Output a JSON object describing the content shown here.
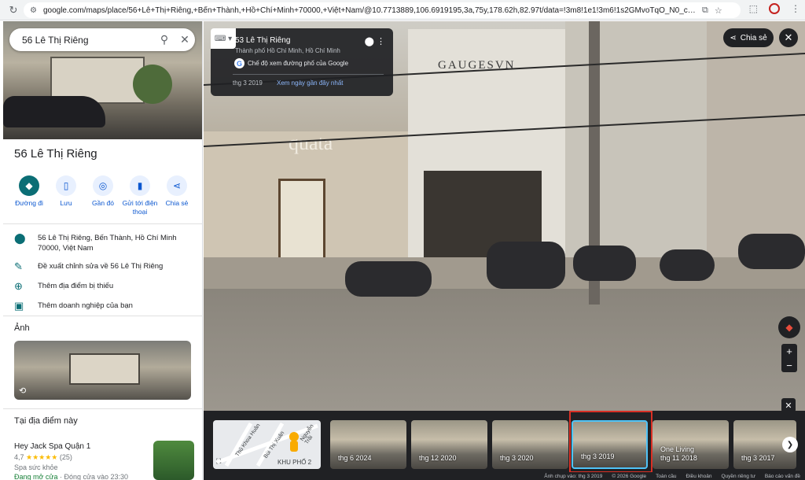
{
  "browser": {
    "url": "google.com/maps/place/56+Lê+Thị+Riêng,+Bến+Thành,+Hồ+Chí+Minh+70000,+Việt+Nam/@10.7713889,106.6919195,3a,75y,178.62h,82.97t/data=!3m8!1e1!3m6!1s2GMvoTqO_N0_csyy1rDdA!2e0!5s20190301T0..."
  },
  "search": {
    "query": "56 Lê Thị Riêng"
  },
  "place": {
    "title": "56 Lê Thị Riêng",
    "actions": [
      {
        "label": "Đường đi",
        "icon": "directions-icon"
      },
      {
        "label": "Lưu",
        "icon": "bookmark-icon"
      },
      {
        "label": "Gần đó",
        "icon": "nearby-icon"
      },
      {
        "label": "Gửi tới điện thoại",
        "icon": "phone-icon"
      },
      {
        "label": "Chia sẻ",
        "icon": "share-icon"
      }
    ],
    "address": "56 Lê Thị Riêng, Bến Thành, Hồ Chí Minh 70000, Việt Nam",
    "suggest_edit": "Đề xuất chỉnh sửa về 56 Lê Thị Riêng",
    "add_missing": "Thêm địa điểm bị thiếu",
    "add_business": "Thêm doanh nghiệp của bạn",
    "photos_title": "Ảnh",
    "nearby_title": "Tại địa điểm này"
  },
  "business": {
    "name": "Hey Jack Spa Quận 1",
    "rating": "4,7",
    "stars": "★★★★★",
    "reviews": "(25)",
    "type": "Spa sức khỏe",
    "open_status": "Đang mở cửa",
    "hours": " · Đóng cửa vào 23:30"
  },
  "streetview": {
    "address": "53 Lê Thị Riêng",
    "city": "Thành phố Hồ Chí Minh, Hồ Chí Minh",
    "mode": "Chế độ xem đường phố của Google",
    "date": "thg 3 2019",
    "latest_link": "Xem ngày gần đây nhất",
    "share_label": "Chia sẻ",
    "sign_gauges": "GAUGESVN",
    "sign_quata": "quata"
  },
  "timeline": {
    "map_road1": "Thủ Khoa Huân",
    "map_road2": "Bùi Thị Xuân",
    "map_road3": "Nguyễn Trãi",
    "map_area": "KHU PHỐ 2",
    "thumbnails": [
      {
        "label": "thg 6 2024"
      },
      {
        "label": "thg 12 2020"
      },
      {
        "label": "thg 3 2020"
      },
      {
        "label": "thg 3 2019"
      },
      {
        "label": "One Living",
        "label2": "thg 11 2018"
      },
      {
        "label": "thg 3 2017"
      }
    ]
  },
  "footer": {
    "capture": "Ảnh chụp vào: thg 3 2019",
    "copyright": "© 2026 Google",
    "links": [
      "Toàn cầu",
      "Điều khoản",
      "Quyền riêng tư",
      "Báo cáo vấn đề"
    ]
  }
}
